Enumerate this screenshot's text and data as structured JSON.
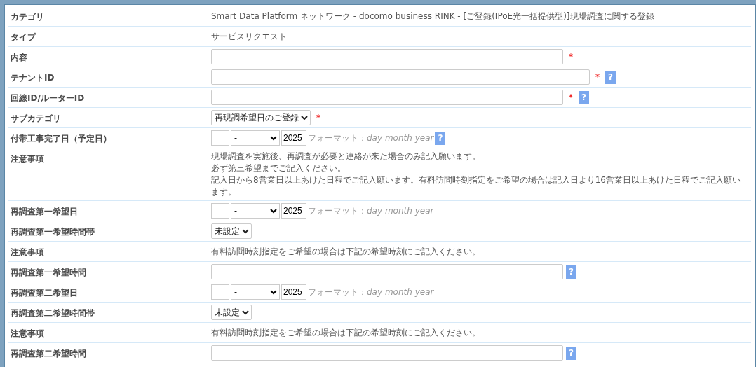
{
  "rows": [
    {
      "label": "カテゴリ",
      "kind": "text",
      "text": "Smart Data Platform ネットワーク - docomo business RINK - [ご登録(IPoE光一括提供型)]現場調査に関する登録"
    },
    {
      "label": "タイプ",
      "kind": "text",
      "text": "サービスリクエスト"
    },
    {
      "label": "内容",
      "kind": "input",
      "wide": false,
      "required": true,
      "help": false
    },
    {
      "label": "テナントID",
      "kind": "input",
      "wide": true,
      "required": true,
      "help": true
    },
    {
      "label": "回線ID/ルーターID",
      "kind": "input",
      "wide": false,
      "required": true,
      "help": true
    },
    {
      "label": "サブカテゴリ",
      "kind": "select",
      "value": "再現調希望日のご登録",
      "required": true
    },
    {
      "label": "付帯工事完了日（予定日）",
      "kind": "date",
      "month": "-",
      "year": "2025",
      "format_label": "フォーマット：",
      "format": "day month year",
      "help": true
    },
    {
      "label": "注意事項",
      "kind": "note",
      "lines": [
        "現場調査を実施後、再調査が必要と連絡が来た場合のみ記入願います。",
        "必ず第三希望までご記入ください。",
        "記入日から8営業日以上あけた日程でご記入願います。有料訪問時刻指定をご希望の場合は記入日より16営業日以上あけた日程でご記入願います。"
      ]
    },
    {
      "label": "再調査第一希望日",
      "kind": "date",
      "month": "-",
      "year": "2025",
      "format_label": "フォーマット：",
      "format": "day month year",
      "help": false
    },
    {
      "label": "再調査第一希望時間帯",
      "kind": "select",
      "value": "未設定",
      "required": false
    },
    {
      "label": "注意事項",
      "kind": "text",
      "text": "有料訪問時刻指定をご希望の場合は下記の希望時刻にご記入ください。"
    },
    {
      "label": "再調査第一希望時間",
      "kind": "input",
      "wide": false,
      "required": false,
      "help": true
    },
    {
      "label": "再調査第二希望日",
      "kind": "date",
      "month": "-",
      "year": "2025",
      "format_label": "フォーマット：",
      "format": "day month year",
      "help": false
    },
    {
      "label": "再調査第二希望時間帯",
      "kind": "select",
      "value": "未設定",
      "required": false
    },
    {
      "label": "注意事項",
      "kind": "text",
      "text": "有料訪問時刻指定をご希望の場合は下記の希望時刻にご記入ください。"
    },
    {
      "label": "再調査第二希望時間",
      "kind": "input",
      "wide": false,
      "required": false,
      "help": true
    }
  ],
  "help_mark": "?",
  "required_mark": "*"
}
